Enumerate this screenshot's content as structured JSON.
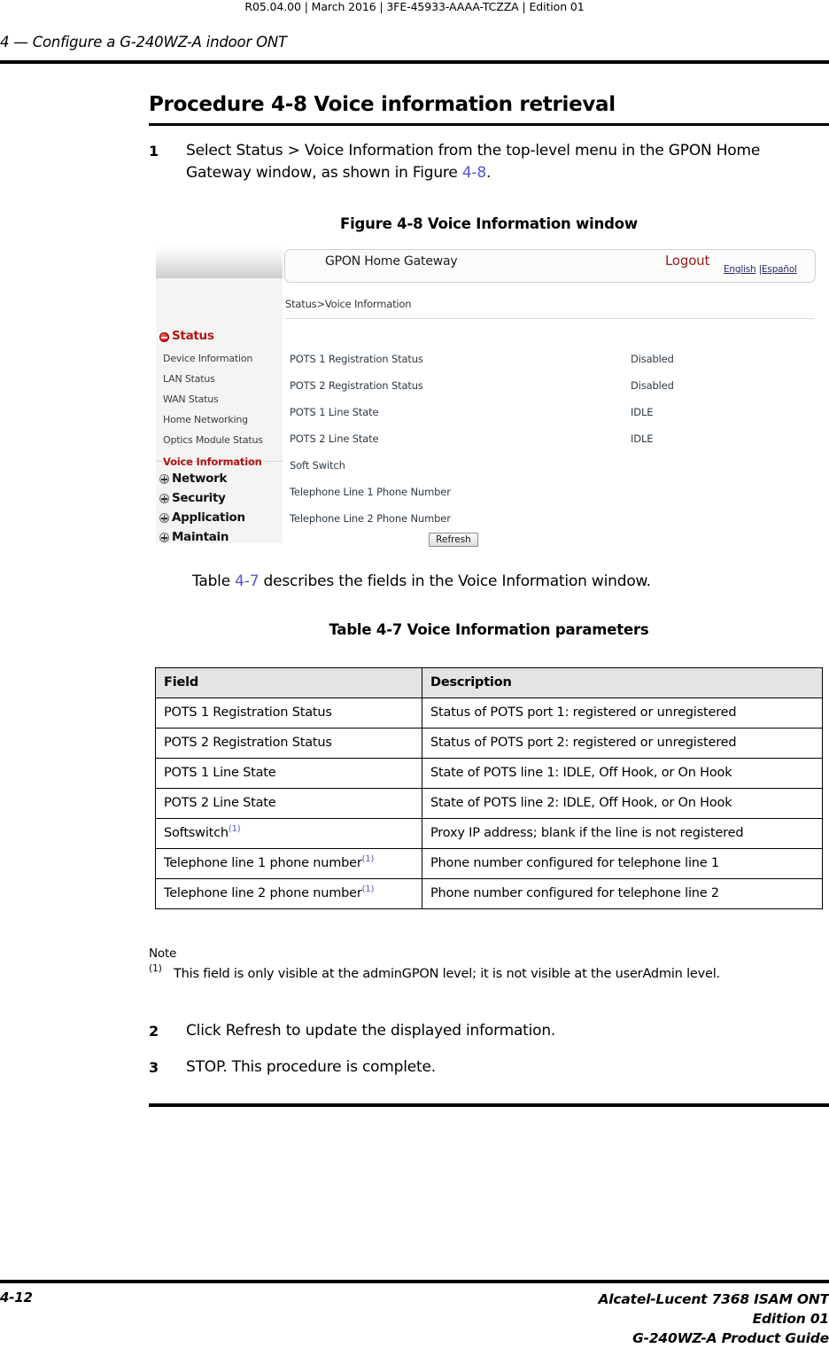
{
  "header": {
    "meta": "R05.04.00 | March 2016 | 3FE-45933-AAAA-TCZZA | Edition 01",
    "chapter": "4 —  Configure a G-240WZ-A indoor ONT"
  },
  "procedure": {
    "title": "Procedure 4-8  Voice information retrieval",
    "steps": [
      {
        "num": "1",
        "text_before": "Select Status > Voice Information from the top-level menu in the GPON Home Gateway window, as shown in Figure ",
        "xref": "4-8",
        "text_after": "."
      },
      {
        "num": "2",
        "text": "Click Refresh to update the displayed information."
      },
      {
        "num": "3",
        "text": "STOP. This procedure is complete."
      }
    ]
  },
  "figure": {
    "caption": "Figure 4-8  Voice Information window",
    "window": {
      "app_name": "GPON Home Gateway",
      "logout_label": "Logout",
      "lang_english": "English",
      "lang_separator": " |",
      "lang_spanish": "Español",
      "breadcrumb": "Status>Voice Information",
      "refresh_label": "Refresh",
      "sidebar": {
        "groups": [
          {
            "label": "Status",
            "icon": "minus-circle-icon",
            "state": "expanded",
            "selected": true
          },
          {
            "label": "Network",
            "icon": "plus-circle-icon",
            "state": "collapsed",
            "selected": false
          },
          {
            "label": "Security",
            "icon": "plus-circle-icon",
            "state": "collapsed",
            "selected": false
          },
          {
            "label": "Application",
            "icon": "plus-circle-icon",
            "state": "collapsed",
            "selected": false
          },
          {
            "label": "Maintain",
            "icon": "plus-circle-icon",
            "state": "collapsed",
            "selected": false
          }
        ],
        "status_items": [
          {
            "label": "Device Information",
            "selected": false
          },
          {
            "label": "LAN Status",
            "selected": false
          },
          {
            "label": "WAN Status",
            "selected": false
          },
          {
            "label": "Home Networking",
            "selected": false
          },
          {
            "label": "Optics Module Status",
            "selected": false
          },
          {
            "label": "Voice Information",
            "selected": true
          }
        ]
      },
      "fields": [
        {
          "label": "POTS 1 Registration Status",
          "value": "Disabled"
        },
        {
          "label": "POTS 2 Registration Status",
          "value": "Disabled"
        },
        {
          "label": "POTS 1 Line State",
          "value": "IDLE"
        },
        {
          "label": "POTS 2 Line State",
          "value": "IDLE"
        },
        {
          "label": "Soft Switch",
          "value": ""
        },
        {
          "label": "Telephone Line 1 Phone Number",
          "value": ""
        },
        {
          "label": "Telephone Line 2 Phone Number",
          "value": ""
        }
      ]
    }
  },
  "table_intro": {
    "before": "Table ",
    "xref": "4-7",
    "after": " describes the fields in the Voice Information window."
  },
  "table": {
    "caption": "Table 4-7 Voice Information parameters",
    "columns": [
      "Field",
      "Description"
    ],
    "rows": [
      {
        "field": "POTS 1 Registration Status",
        "footnote": "",
        "description": "Status of POTS port 1: registered or unregistered"
      },
      {
        "field": "POTS 2 Registration Status",
        "footnote": "",
        "description": "Status of POTS port 2: registered or unregistered"
      },
      {
        "field": "POTS 1 Line State",
        "footnote": "",
        "description": "State of POTS line 1: IDLE, Off Hook, or On Hook"
      },
      {
        "field": "POTS 2 Line State",
        "footnote": "",
        "description": "State of POTS line 2: IDLE, Off Hook, or On Hook"
      },
      {
        "field": "Softswitch",
        "footnote": "(1)",
        "description": "Proxy IP address; blank if the line is not registered"
      },
      {
        "field": "Telephone line 1 phone number",
        "footnote": "(1)",
        "description": "Phone number configured for telephone line 1"
      },
      {
        "field": "Telephone line 2 phone number",
        "footnote": "(1)",
        "description": "Phone number configured for telephone line 2"
      }
    ]
  },
  "note": {
    "label": "Note",
    "marker": "(1)",
    "text": "This field is only visible at the adminGPON level; it is not visible at the userAdmin level."
  },
  "footer": {
    "page_number": "4-12",
    "line1": "Alcatel-Lucent 7368 ISAM ONT",
    "line2": "Edition 01",
    "line3": "G-240WZ-A Product Guide"
  },
  "colors": {
    "xref": "#5555cc",
    "accent_red": "#b01515",
    "logout_red": "#9b1b1b",
    "table_header_bg": "#e4e4e4"
  }
}
